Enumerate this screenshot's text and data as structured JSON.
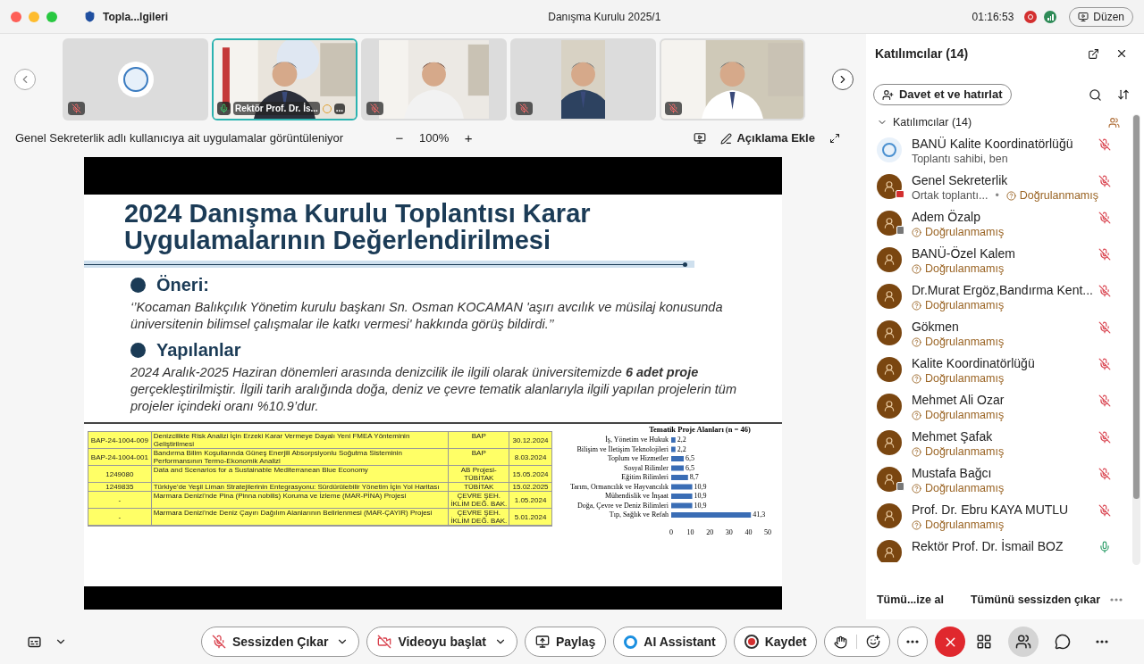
{
  "window": {
    "tab_title": "Topla...lgileri",
    "title": "Danışma Kurulu 2025/1",
    "timer": "01:16:53",
    "layout_button": "Düzen"
  },
  "thumbnails": [
    {
      "kind": "logo",
      "muted": true,
      "selected": false
    },
    {
      "kind": "video",
      "name": "Rektör Prof. Dr. İs...",
      "more": "...",
      "muted": false,
      "selected": true
    },
    {
      "kind": "video",
      "muted": true,
      "selected": false
    },
    {
      "kind": "video",
      "muted": true,
      "selected": false
    },
    {
      "kind": "video",
      "muted": true,
      "selected": false
    }
  ],
  "share_bar": {
    "label": "Genel Sekreterlik adlı kullanıcıya ait uygulamalar görüntüleniyor",
    "zoom_out": "−",
    "zoom": "100%",
    "zoom_in": "+",
    "annotate": "Açıklama Ekle"
  },
  "slide": {
    "title": "2024 Danışma Kurulu Toplantısı Karar Uygulamalarının Değerlendirilmesi",
    "sections": [
      {
        "heading": "Öneri:",
        "text": "‘’Kocaman Balıkçılık Yönetim kurulu başkanı Sn. Osman KOCAMAN 'aşırı avcılık ve müsilaj konusunda üniversitenin bilimsel çalışmalar ile katkı vermesi' hakkında görüş bildirdi.’’"
      },
      {
        "heading": "Yapılanlar",
        "text": "2024 Aralık-2025 Haziran dönemleri arasında denizcilik ile ilgili olarak üniversitemizde **6 adet proje** gerçekleştirilmiştir. İlgili tarih aralığında doğa, deniz ve çevre tematik alanlarıyla ilgili yapılan projelerin tüm projeler içindeki oranı %10.9’dur."
      }
    ],
    "table": {
      "rows": [
        [
          "BAP-24-1004-009",
          "Denizcilikte Risk Analizi İçin Erzeki Karar Vermeye Dayalı Yeni FMEA Yönteminin Geliştirilmesi",
          "BAP",
          "30.12.2024"
        ],
        [
          "BAP-24-1004-001",
          "Bandırma Bilim Koşullarında Güneş Enerjili Absorpsiyonlu Soğutma Sisteminin Performansının Termo-Ekonomik Analizi",
          "BAP",
          "8.03.2024"
        ],
        [
          "1249080",
          "Data and Scenarios for a Sustainable Mediterranean Blue Economy",
          "AB Projesi-TÜBİTAK",
          "15.05.2024"
        ],
        [
          "1249835",
          "Türkiye'de Yeşil Liman Stratejilerinin Entegrasyonu: Sürdürülebilir Yönetim İçin Yol Haritası",
          "TÜBİTAK",
          "15.02.2025"
        ],
        [
          "-",
          "Marmara Denizi'nde Pina (Pinna nobilis) Koruma ve İzleme (MAR-PİNA) Projesi",
          "ÇEVRE ŞEH. İKLİM DEĞ. BAK.",
          "1.05.2024"
        ],
        [
          "-",
          "Marmara Denizi'nde Deniz Çayırı Dağılım Alanlarının Belirlenmesi (MAR-ÇAYIR) Projesi",
          "ÇEVRE ŞEH. İKLİM DEĞ. BAK.",
          "5.01.2024"
        ]
      ]
    },
    "chart_data": {
      "type": "bar",
      "orientation": "horizontal",
      "title": "Tematik Proje Alanları (n = 46)",
      "categories": [
        "İş, Yönetim ve Hukuk",
        "Bilişim ve İletişim Teknolojileri",
        "Toplum ve Hizmetler",
        "Sosyal Bilimler",
        "Eğitim Bilimleri",
        "Tarım, Ormancılık ve Hayvancılık",
        "Mühendislik ve İnşaat",
        "Doğa, Çevre ve Deniz Bilimleri",
        "Tıp, Sağlık ve Refah"
      ],
      "values": [
        2.2,
        2.2,
        6.5,
        6.5,
        8.7,
        10.9,
        10.9,
        10.9,
        41.3
      ],
      "value_labels": [
        "2,2",
        "2,2",
        "6,5",
        "6,5",
        "8,7",
        "10,9",
        "10,9",
        "10,9",
        "41,3"
      ],
      "xlim": [
        0,
        50
      ],
      "xticks": [
        0,
        10,
        20,
        30,
        40,
        50
      ]
    }
  },
  "participants_panel": {
    "title": "Katılımcılar (14)",
    "invite_button": "Davet et ve hatırlat",
    "group": "Katılımcılar (14)",
    "expanded": true,
    "participants": [
      {
        "name": "BANÜ Kalite Koordinatörlüğü",
        "kind": "host",
        "note": "Toplantı sahibi, ben",
        "muted": true
      },
      {
        "name": "Genel Sekreterlik",
        "kind": "guest",
        "badge": {
          "kind": "sharing"
        },
        "note": "Ortak toplantı...",
        "separator": "•",
        "status": "Doğrulanmamış",
        "muted": true
      },
      {
        "name": "Adem Özalp",
        "kind": "guest",
        "badge": {
          "kind": "device"
        },
        "status": "Doğrulanmamış",
        "muted": true
      },
      {
        "name": "BANÜ-Özel Kalem",
        "kind": "guest",
        "status": "Doğrulanmamış",
        "muted": true
      },
      {
        "name": "Dr.Murat Ergöz,Bandırma Kent...",
        "kind": "guest",
        "status": "Doğrulanmamış",
        "muted": true
      },
      {
        "name": "Gökmen",
        "kind": "guest",
        "status": "Doğrulanmamış",
        "muted": true
      },
      {
        "name": "Kalite Koordinatörlüğü",
        "kind": "guest",
        "status": "Doğrulanmamış",
        "muted": true
      },
      {
        "name": "Mehmet Ali Ozar",
        "kind": "guest",
        "status": "Doğrulanmamış",
        "muted": true
      },
      {
        "name": "Mehmet Şafak",
        "kind": "guest",
        "status": "Doğrulanmamış",
        "muted": true
      },
      {
        "name": "Mustafa  Bağcı",
        "kind": "guest",
        "badge": {
          "kind": "device"
        },
        "status": "Doğrulanmamış",
        "muted": true
      },
      {
        "name": "Prof. Dr. Ebru KAYA MUTLU",
        "kind": "guest",
        "status": "Doğrulanmamış",
        "muted": true
      },
      {
        "name": "Rektör Prof. Dr. İsmail BOZ",
        "kind": "guest",
        "muted": false
      }
    ],
    "footer": [
      "Tümü...ize al",
      "Tümünü sessizden çıkar"
    ]
  },
  "toolbar": {
    "buttons": [
      {
        "kind": "mute",
        "label": "Sessizden Çıkar",
        "menu": true
      },
      {
        "kind": "video",
        "label": "Videoyu başlat",
        "menu": true
      },
      {
        "kind": "share",
        "label": "Paylaş",
        "menu": false
      },
      {
        "kind": "ai",
        "label": "AI Assistant",
        "menu": false
      },
      {
        "kind": "record",
        "label": "Kaydet",
        "menu": false
      }
    ],
    "right": [
      {
        "kind": "apps",
        "selected": false
      },
      {
        "kind": "participants",
        "selected": true
      },
      {
        "kind": "chat",
        "selected": false
      },
      {
        "kind": "more",
        "selected": false
      }
    ]
  }
}
